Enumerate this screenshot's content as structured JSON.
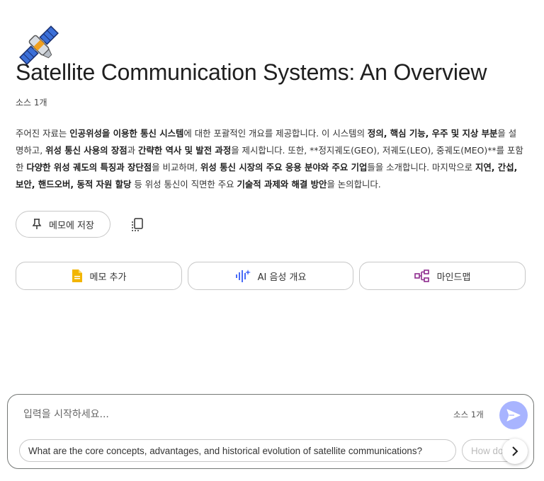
{
  "note": {
    "emoji_icon": "satellite-emoji",
    "title": "Satellite Communication Systems: An Overview",
    "source_count": "소스 1개",
    "summary": [
      {
        "t": "주어진 자료는 "
      },
      {
        "t": "인공위성을 이용한 통신 시스템",
        "b": true
      },
      {
        "t": "에 대한 포괄적인 개요를 제공합니다. 이 시스템의 "
      },
      {
        "t": "정의, 핵심 기능, 우주 및 지상 부분",
        "b": true
      },
      {
        "t": "을 설명하고, "
      },
      {
        "t": "위성 통신 사용의 장점",
        "b": true
      },
      {
        "t": "과 "
      },
      {
        "t": "간략한 역사 및 발전 과정",
        "b": true
      },
      {
        "t": "을 제시합니다. 또한, **정지궤도(GEO), 저궤도(LEO), 중궤도(MEO)**를 포함한 "
      },
      {
        "t": "다양한 위성 궤도의 특징과 장단점",
        "b": true
      },
      {
        "t": "을 비교하며, "
      },
      {
        "t": "위성 통신 시장의 주요 응용 분야와 주요 기업",
        "b": true
      },
      {
        "t": "들을 소개합니다. 마지막으로 "
      },
      {
        "t": "지연, 간섭, 보안, 핸드오버, 동적 자원 할당",
        "b": true
      },
      {
        "t": " 등 위성 통신이 직면한 주요 "
      },
      {
        "t": "기술적 과제와 해결 방안",
        "b": true
      },
      {
        "t": "을 논의합니다."
      }
    ]
  },
  "actions": {
    "save_to_memo": "메모에 저장",
    "add_memo": "메모 추가",
    "audio_overview": "AI 음성 개요",
    "mind_map": "마인드맵"
  },
  "chat": {
    "placeholder": "입력을 시작하세요...",
    "source_count": "소스 1개",
    "suggestions": [
      "What are the core concepts, advantages, and historical evolution of satellite communications?",
      "How do"
    ]
  },
  "colors": {
    "accent_send": "#a8b4ff",
    "memo_icon": "#f2b500",
    "audio_icon": "#4a6cf7",
    "mindmap_icon": "#8e2b8e"
  }
}
